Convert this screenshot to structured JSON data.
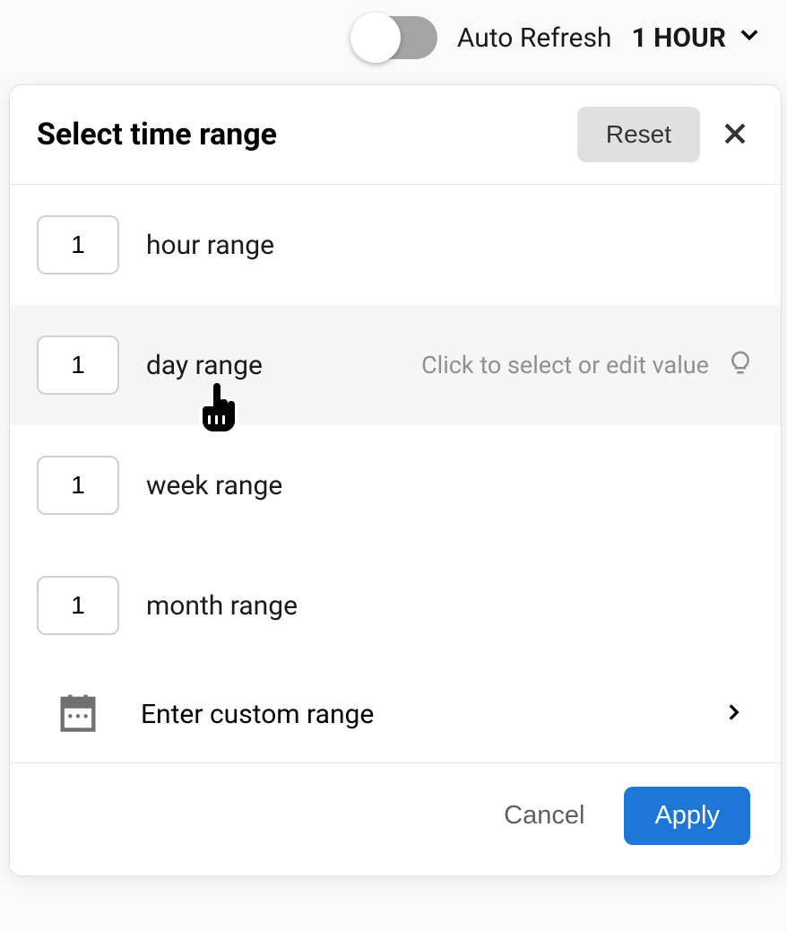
{
  "topbar": {
    "auto_refresh_label": "Auto Refresh",
    "auto_refresh_on": false,
    "selected_range": "1 HOUR"
  },
  "modal": {
    "title": "Select time range",
    "reset_label": "Reset",
    "ranges": [
      {
        "value": "1",
        "label": "hour range"
      },
      {
        "value": "1",
        "label": "day range"
      },
      {
        "value": "1",
        "label": "week range"
      },
      {
        "value": "1",
        "label": "month range"
      }
    ],
    "hovered_hint": "Click to select or edit value",
    "hovered_index": 1,
    "custom_label": "Enter custom range",
    "cancel_label": "Cancel",
    "apply_label": "Apply"
  }
}
